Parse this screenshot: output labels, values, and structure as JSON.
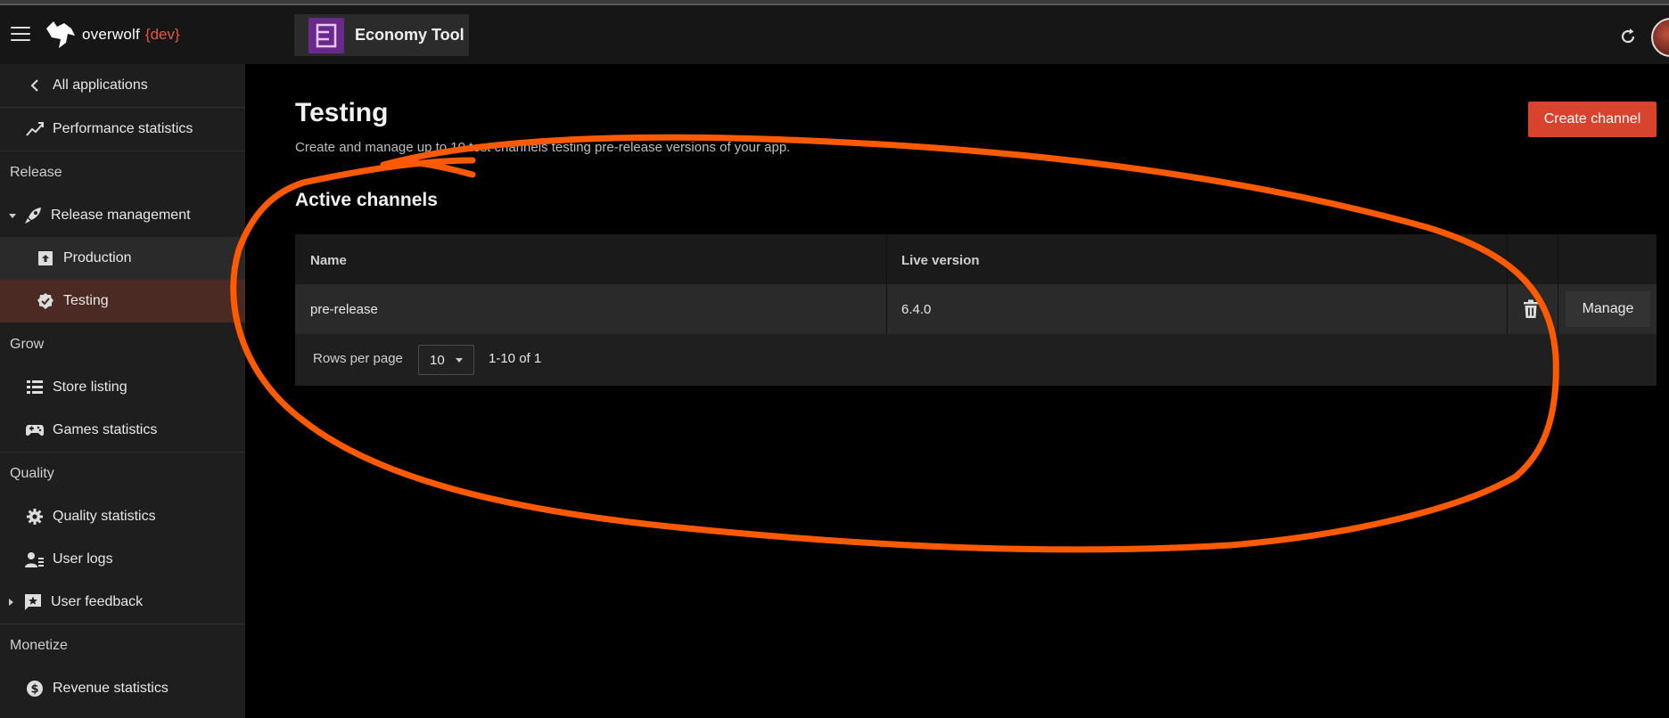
{
  "header": {
    "logo_text": "overwolf",
    "logo_dev": "{dev}",
    "app_name": "Economy Tool"
  },
  "sidebar": {
    "items": [
      {
        "label": "All applications",
        "icon": "chevron-left-icon"
      },
      {
        "label": "Performance statistics",
        "icon": "trend-chart-icon"
      }
    ],
    "sections": {
      "release": "Release",
      "grow": "Grow",
      "quality": "Quality",
      "monetize": "Monetize"
    },
    "release_items": {
      "release_management": "Release management",
      "production": "Production",
      "testing": "Testing"
    },
    "grow_items": {
      "store_listing": "Store listing",
      "games_statistics": "Games statistics"
    },
    "quality_items": {
      "quality_statistics": "Quality statistics",
      "user_logs": "User logs",
      "user_feedback": "User feedback"
    },
    "monetize_items": {
      "revenue_statistics": "Revenue statistics"
    }
  },
  "main": {
    "title": "Testing",
    "subtitle": "Create and manage up to 10 test channels testing pre-release versions of your app.",
    "create_button": "Create channel",
    "section_title": "Active channels",
    "table": {
      "columns": [
        "Name",
        "Live version"
      ],
      "rows": [
        {
          "name": "pre-release",
          "live_version": "6.4.0",
          "action": "Manage"
        }
      ],
      "rows_per_page_label": "Rows per page",
      "rows_per_page_value": "10",
      "range_label": "1-10 of 1"
    }
  },
  "colors": {
    "accent": "#d8432e",
    "annotation_stroke": "#ff5a00",
    "active_nav": "#4a2a22",
    "app_icon": "#6a2a8c"
  }
}
